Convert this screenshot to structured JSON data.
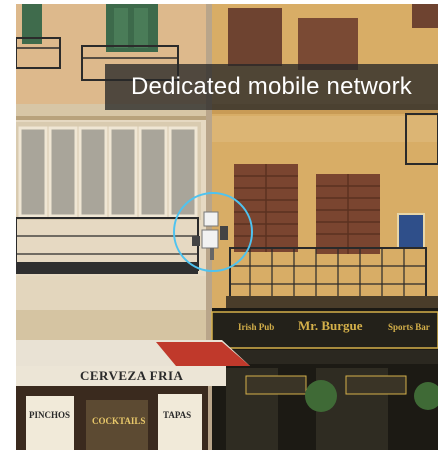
{
  "caption": {
    "text": "Dedicated mobile network"
  },
  "signs": {
    "awning": "CERVEZA FRIA",
    "pub_left": "Irish Pub",
    "pub_mid": "Mr. Burgue",
    "pub_right": "Sports Bar",
    "menu_1": "PINCHOS",
    "menu_2": "TAPAS",
    "cocktails": "COCKTAILS"
  },
  "colors": {
    "highlight_ring": "#4ec3f0",
    "caption_bg": "#282828",
    "facade_left": "#e8dcc8",
    "facade_right": "#d9b06a",
    "shutters": "#7a4a34",
    "awning": "#e9e2d4",
    "awning_stripe": "#c0392b",
    "pub_front": "#1c1a14",
    "pub_gold": "#d4b04a"
  }
}
